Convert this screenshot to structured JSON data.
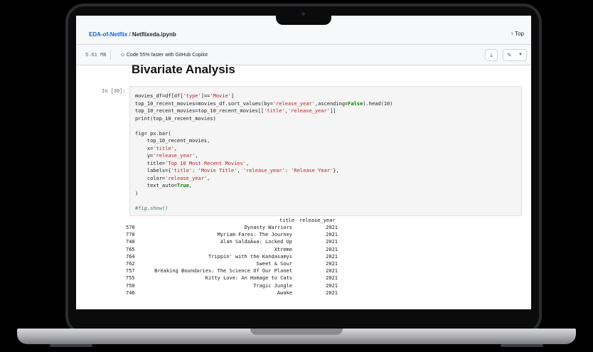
{
  "header": {
    "repo": "EDA-of-Netflix",
    "separator": "/",
    "file": "Netflixeda.ipynb",
    "top_label": "↑ Top"
  },
  "toolbar": {
    "file_size": "5.61 MB",
    "copilot_text": "Code 55% faster with GitHub Copilot",
    "copilot_icon": "copilot-icon",
    "download_icon": "download-icon",
    "edit_icon": "pencil-icon"
  },
  "notebook": {
    "section_title": "Bivariate Analysis",
    "prompt": "In [30]:",
    "code_lines": [
      "movies_df=df[df['type']=='Movie']",
      "top_10_recent_movies=movies_df.sort_values(by='release_year',ascending=False).head(10)",
      "top_10_recent_movies=top_10_recent_movies[['title','release_year']]",
      "print(top_10_recent_movies)",
      "",
      "fig= px.bar(",
      "    top_10_recent_movies,",
      "    x='title',",
      "    y='release_year',",
      "    title='Top 10 Most Recent Movies',",
      "    labels={'title': 'Movie Title', 'release_year': 'Release Year'},",
      "    color='release_year',",
      "    text_auto=True,",
      ")",
      "",
      "#fig.show()"
    ],
    "output": {
      "columns": [
        "title",
        "release_year"
      ],
      "rows": [
        {
          "idx": "570",
          "title": "Dynasty Warriors",
          "year": "2021"
        },
        {
          "idx": "770",
          "title": "Myriam Fares: The Journey",
          "year": "2021"
        },
        {
          "idx": "740",
          "title": "Alan SaldaÃ±a: Locked Up",
          "year": "2021"
        },
        {
          "idx": "765",
          "title": "Xtreme",
          "year": "2021"
        },
        {
          "idx": "764",
          "title": "Trippin' with the Kandasamys",
          "year": "2021"
        },
        {
          "idx": "762",
          "title": "Sweet & Sour",
          "year": "2021"
        },
        {
          "idx": "757",
          "title": "Breaking Boundaries: The Science Of Our Planet",
          "year": "2021"
        },
        {
          "idx": "755",
          "title": "Kitty Love: An Homage to Cats",
          "year": "2021"
        },
        {
          "idx": "750",
          "title": "Tragic Jungle",
          "year": "2021"
        },
        {
          "idx": "746",
          "title": "Awake",
          "year": "2021"
        }
      ]
    }
  }
}
